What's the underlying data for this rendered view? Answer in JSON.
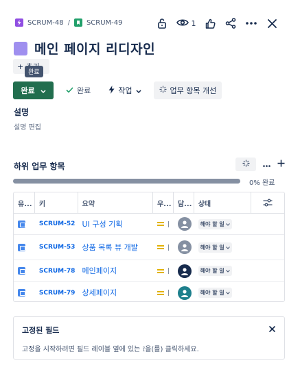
{
  "breadcrumbs": [
    {
      "key": "SCRUM-48",
      "type": "epic"
    },
    {
      "key": "SCRUM-49",
      "type": "story"
    }
  ],
  "breadcrumb_sep": "/",
  "header": {
    "watch_count": "1",
    "icons": [
      "unlock-icon",
      "eye-icon",
      "thumbs-up-icon",
      "share-icon",
      "more-icon",
      "close-icon"
    ]
  },
  "title": "메인 페이지 리디자인",
  "add_button": "+ 추가",
  "tooltip": "완료",
  "actions": {
    "status": "완료",
    "resolved": "완료",
    "work": "작업",
    "improve": "업무 항목 개선"
  },
  "description": {
    "heading": "설명",
    "edit": "설명 편집"
  },
  "subtasks": {
    "heading": "하위 업무 항목",
    "progress_percent": 0,
    "progress_label": "0% 완료",
    "columns": [
      "유...",
      "키",
      "요약",
      "우...",
      "담...",
      "상태"
    ],
    "rows": [
      {
        "key": "SCRUM-52",
        "summary": "UI 구성 기획",
        "status": "해야 할 일",
        "avatar": "gray"
      },
      {
        "key": "SCRUM-53",
        "summary": "상품 목록 뷰 개발",
        "status": "해야 할 일",
        "avatar": "gray"
      },
      {
        "key": "SCRUM-78",
        "summary": "메인페이지",
        "status": "해야 할 일",
        "avatar": "dark"
      },
      {
        "key": "SCRUM-79",
        "summary": "상세페이지",
        "status": "해야 할 일",
        "avatar": "teal"
      }
    ]
  },
  "pinned": {
    "heading": "고정된 필드",
    "text": "고정을 시작하려면 필드 레이블 옆에 있는 ⟟을(를) 클릭하세요."
  },
  "colors": {
    "status_button": "#216e4e",
    "link": "#0c66e4",
    "priority": "#e2b203",
    "title_icon": "#9f8fef"
  }
}
